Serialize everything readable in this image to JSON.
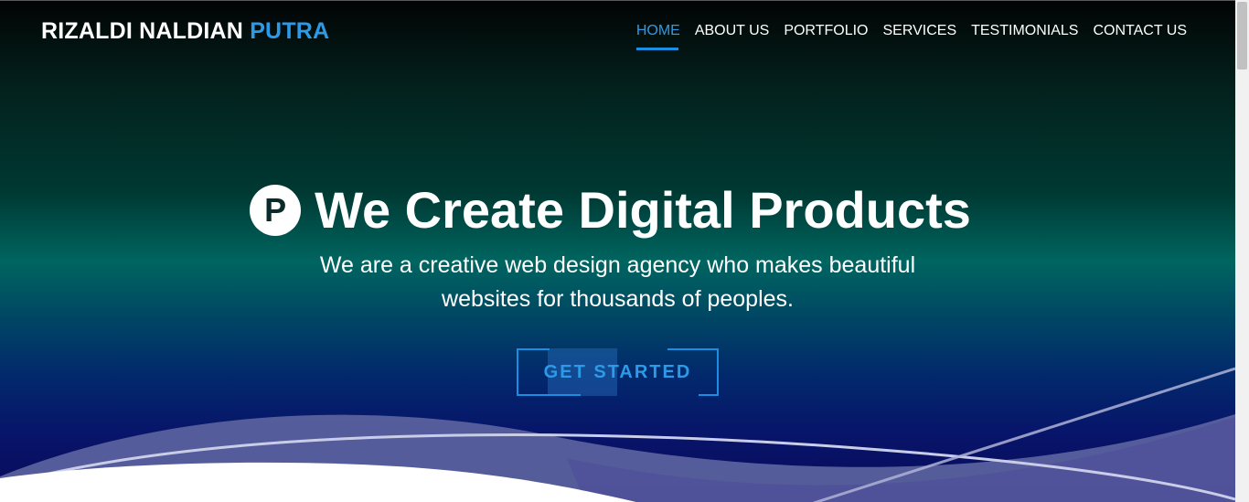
{
  "brand": {
    "name_main": "RIZALDI NALDIAN",
    "name_accent": "PUTRA"
  },
  "nav": {
    "items": [
      {
        "label": "HOME",
        "active": true
      },
      {
        "label": "ABOUT US",
        "active": false
      },
      {
        "label": "PORTFOLIO",
        "active": false
      },
      {
        "label": "SERVICES",
        "active": false
      },
      {
        "label": "TESTIMONIALS",
        "active": false
      },
      {
        "label": "CONTACT US",
        "active": false
      }
    ]
  },
  "hero": {
    "logo_letter": "P",
    "title": "We Create Digital Products",
    "subtitle_line1": "We are a creative web design agency who makes beautiful",
    "subtitle_line2": "websites for thousands of peoples.",
    "cta_label": "GET STARTED"
  },
  "colors": {
    "accent": "#2d9ae8",
    "cta_border": "#1a8ee0",
    "text": "#ffffff"
  }
}
